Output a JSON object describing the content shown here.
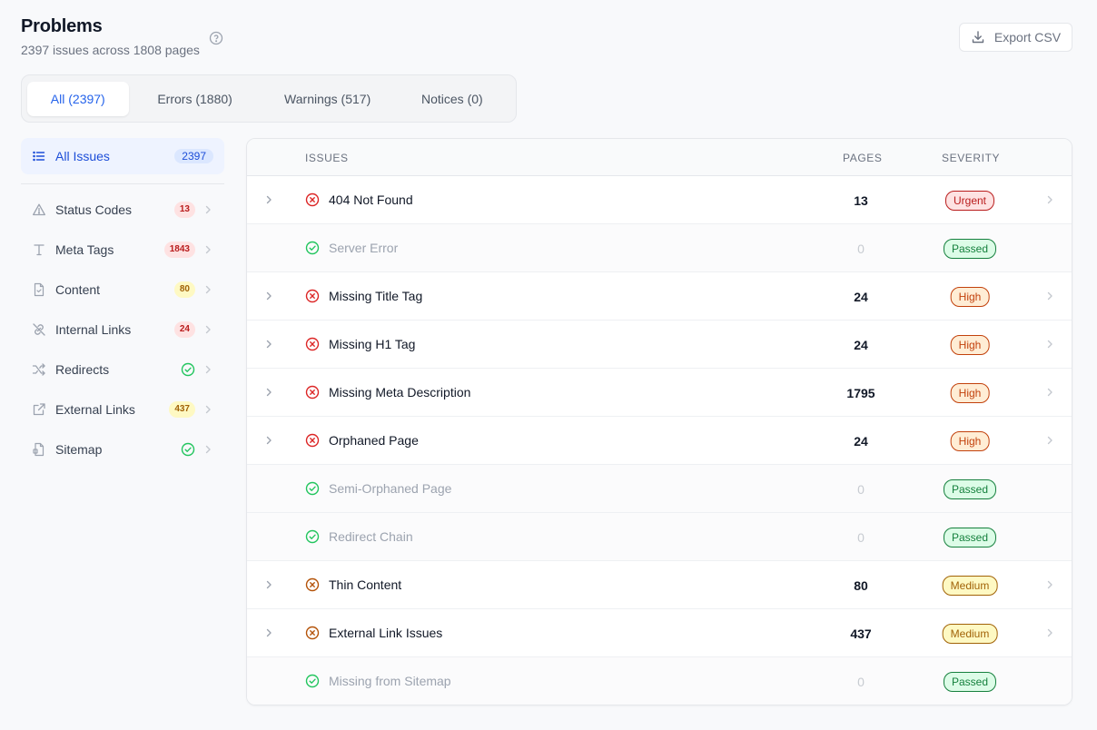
{
  "header": {
    "title": "Problems",
    "subtitle": "2397 issues across 1808 pages",
    "export_label": "Export CSV"
  },
  "tabs": [
    {
      "label": "All (2397)",
      "active": true
    },
    {
      "label": "Errors (1880)",
      "active": false
    },
    {
      "label": "Warnings (517)",
      "active": false
    },
    {
      "label": "Notices (0)",
      "active": false
    }
  ],
  "sidebar": {
    "all": {
      "label": "All Issues",
      "count": "2397"
    },
    "items": [
      {
        "label": "Status Codes",
        "icon": "warning-triangle-icon",
        "badge": "13",
        "badge_color": "red"
      },
      {
        "label": "Meta Tags",
        "icon": "text-t-icon",
        "badge": "1843",
        "badge_color": "red"
      },
      {
        "label": "Content",
        "icon": "document-icon",
        "badge": "80",
        "badge_color": "yellow"
      },
      {
        "label": "Internal Links",
        "icon": "broken-link-icon",
        "badge": "24",
        "badge_color": "red"
      },
      {
        "label": "Redirects",
        "icon": "shuffle-icon",
        "badge": "",
        "badge_color": "check"
      },
      {
        "label": "External Links",
        "icon": "external-link-icon",
        "badge": "437",
        "badge_color": "yellow"
      },
      {
        "label": "Sitemap",
        "icon": "sitemap-file-icon",
        "badge": "",
        "badge_color": "check"
      }
    ]
  },
  "table": {
    "headers": {
      "issues": "ISSUES",
      "pages": "PAGES",
      "severity": "SEVERITY"
    },
    "rows": [
      {
        "issue": "404 Not Found",
        "pages": "13",
        "severity": "Urgent",
        "status": "error"
      },
      {
        "issue": "Server Error",
        "pages": "0",
        "severity": "Passed",
        "status": "passed"
      },
      {
        "issue": "Missing Title Tag",
        "pages": "24",
        "severity": "High",
        "status": "error"
      },
      {
        "issue": "Missing H1 Tag",
        "pages": "24",
        "severity": "High",
        "status": "error"
      },
      {
        "issue": "Missing Meta Description",
        "pages": "1795",
        "severity": "High",
        "status": "error"
      },
      {
        "issue": "Orphaned Page",
        "pages": "24",
        "severity": "High",
        "status": "error"
      },
      {
        "issue": "Semi-Orphaned Page",
        "pages": "0",
        "severity": "Passed",
        "status": "passed"
      },
      {
        "issue": "Redirect Chain",
        "pages": "0",
        "severity": "Passed",
        "status": "passed"
      },
      {
        "issue": "Thin Content",
        "pages": "80",
        "severity": "Medium",
        "status": "warning"
      },
      {
        "issue": "External Link Issues",
        "pages": "437",
        "severity": "Medium",
        "status": "warning"
      },
      {
        "issue": "Missing from Sitemap",
        "pages": "0",
        "severity": "Passed",
        "status": "passed"
      }
    ]
  },
  "colors": {
    "accent": "#2563eb",
    "error": "#dc2626",
    "warning": "#b45309",
    "passed": "#22c55e"
  }
}
